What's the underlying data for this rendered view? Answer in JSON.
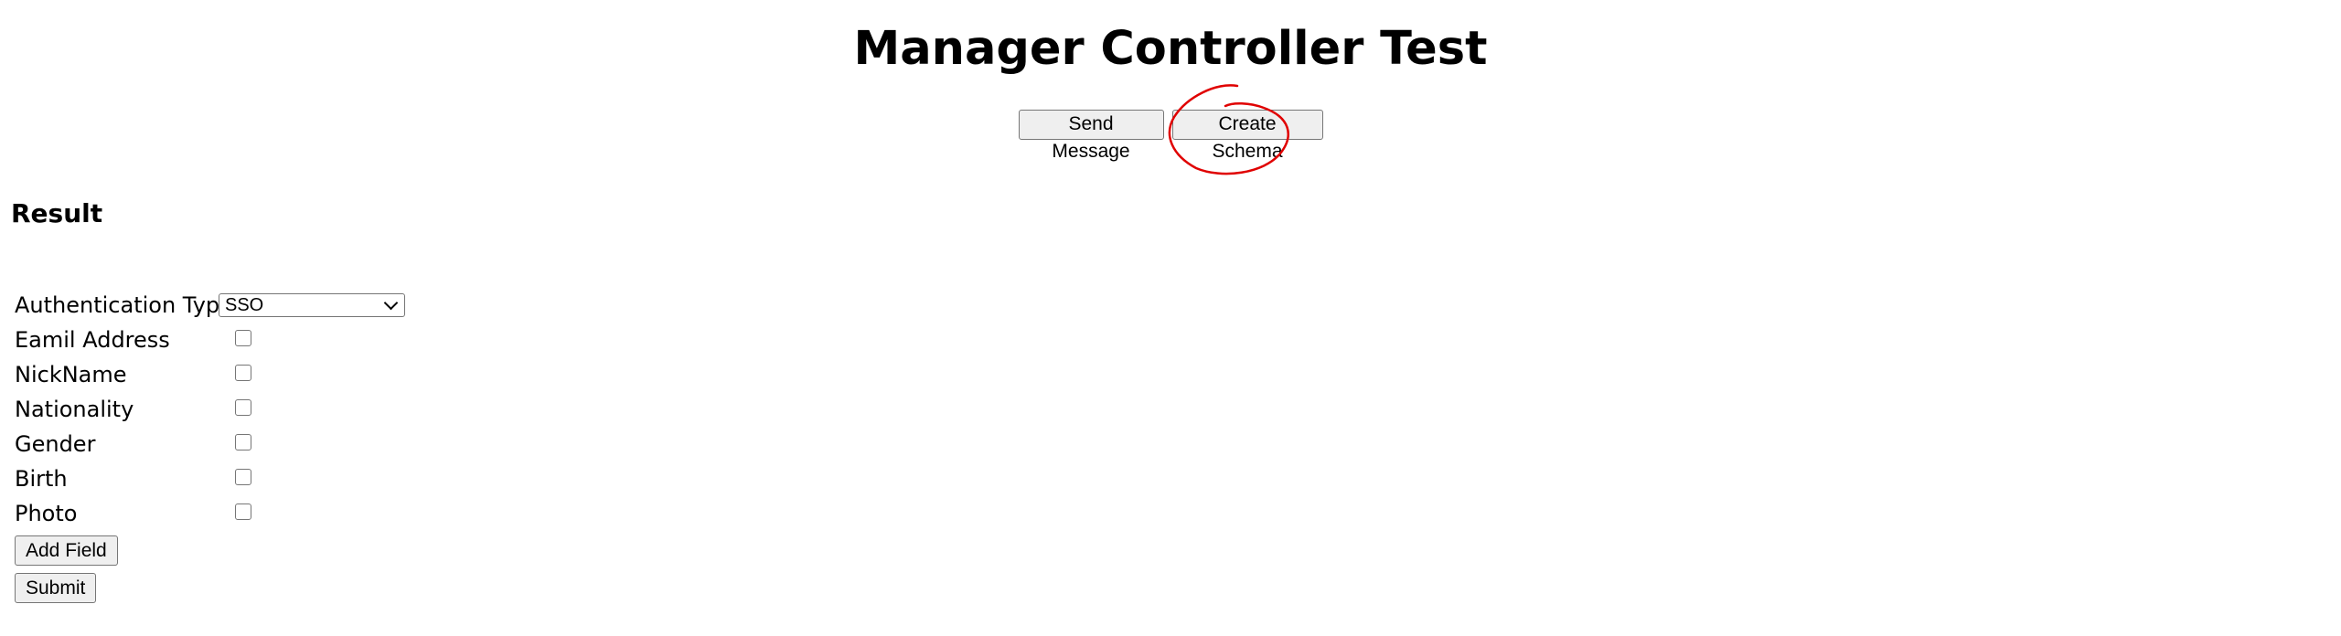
{
  "title": "Manager Controller Test",
  "buttons": {
    "send_message": "Send Message",
    "create_schema": "Create Schema"
  },
  "result": {
    "heading": "Result"
  },
  "form": {
    "auth_label": "Authentication Type",
    "auth_selected": "SSO",
    "fields": [
      {
        "label": "Eamil Address",
        "checked": false
      },
      {
        "label": "NickName",
        "checked": false
      },
      {
        "label": "Nationality",
        "checked": false
      },
      {
        "label": "Gender",
        "checked": false
      },
      {
        "label": "Birth",
        "checked": false
      },
      {
        "label": "Photo",
        "checked": false
      }
    ],
    "add_field_label": "Add Field",
    "submit_label": "Submit"
  },
  "colors": {
    "annotation": "#e00000",
    "button_bg": "#efefef",
    "button_border": "#767676"
  }
}
